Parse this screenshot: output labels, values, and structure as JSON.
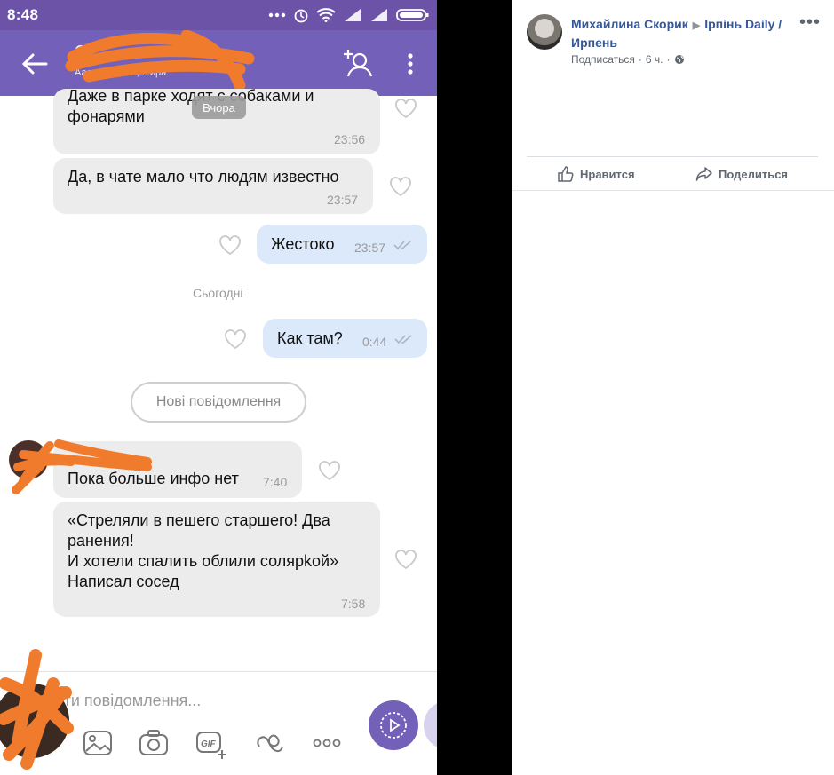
{
  "status_bar": {
    "time": "8:48"
  },
  "chat_header": {
    "title": "О",
    "subtitle": "Аааня, Аааня, ...ира"
  },
  "messages": {
    "m1": {
      "text_line1": "Даже в парке ходят с собаками и",
      "text_line2": "фонарями",
      "time": "23:56"
    },
    "yesterday_badge": "Вчора",
    "m2": {
      "text": "Да, в чате мало что людям известно",
      "time": "23:57"
    },
    "m3": {
      "text": "Жестоко",
      "time": "23:57"
    },
    "today_label": "Сьогодні",
    "m4": {
      "text": "Как там?",
      "time": "0:44"
    },
    "new_messages_label": "Нові повідомлення",
    "m5": {
      "text": "Пока больше инфо нет",
      "time": "7:40"
    },
    "m6": {
      "line1": "«Стреляли в пешего старшего! Два",
      "line2": "ранения!",
      "line3": "И хотели спалить облили солярkой»",
      "line4": "Написал сосед",
      "time": "7:58"
    }
  },
  "compose": {
    "placeholder": "ати повідомлення..."
  },
  "facebook_post": {
    "author": "Михайлина Скорик",
    "group": "Ірпінь Daily / Ирпень",
    "subscribe": "Подписаться",
    "time": "6 ч.",
    "like_label": "Нравится",
    "share_label": "Поделиться"
  },
  "colors": {
    "viber_purple": "#7360b8",
    "fb_link": "#365899",
    "overlay_orange": "#f07b2c"
  }
}
